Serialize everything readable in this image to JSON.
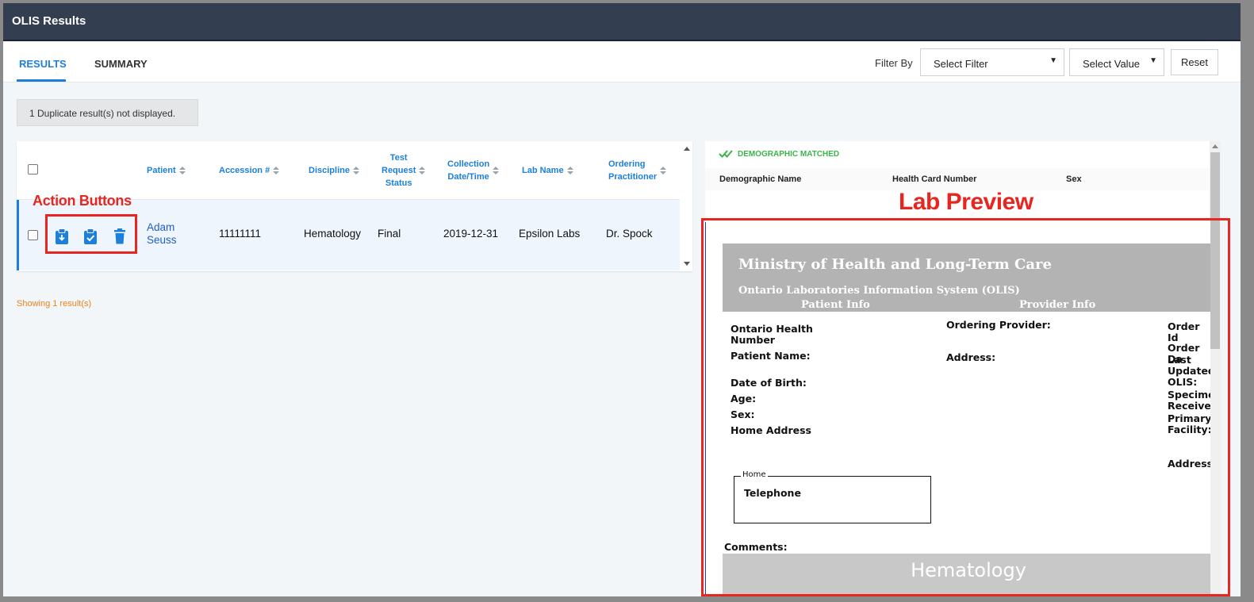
{
  "window": {
    "title": "OLIS Results"
  },
  "tabs": [
    {
      "label": "RESULTS",
      "active": true
    },
    {
      "label": "SUMMARY",
      "active": false
    }
  ],
  "filter": {
    "label": "Filter By",
    "select_filter": "Select Filter",
    "select_value": "Select Value",
    "reset": "Reset"
  },
  "notice": {
    "duplicate": "1 Duplicate result(s) not displayed."
  },
  "table": {
    "headers": {
      "patient": "Patient",
      "accession": "Accession #",
      "discipline": "Discipline",
      "status_l1": "Test",
      "status_l2": "Request",
      "status_l3": "Status",
      "collection_l1": "Collection",
      "collection_l2": "Date/Time",
      "lab": "Lab Name",
      "ordering_l1": "Ordering",
      "ordering_l2": "Practitioner"
    },
    "rows": [
      {
        "patient_first": "Adam",
        "patient_last": "Seuss",
        "accession": "11111111",
        "discipline": "Hematology",
        "status": "Final",
        "collection": "2019-12-31",
        "lab": "Epsilon Labs",
        "practitioner": "Dr. Spock"
      }
    ]
  },
  "annotations": {
    "action_buttons": "Action Buttons",
    "lab_preview": "Lab Preview"
  },
  "showing": "Showing 1 result(s)",
  "demographic": {
    "status": "DEMOGRAPHIC MATCHED",
    "col_name": "Demographic Name",
    "col_hcn": "Health Card Number",
    "col_sex": "Sex"
  },
  "report": {
    "ministry": "Ministry of Health and Long-Term Care",
    "system": "Ontario Laboratories Information System (OLIS)",
    "patient_info": "Patient Info",
    "provider_info": "Provider Info",
    "ohn_l1": "Ontario Health",
    "ohn_l2": "Number",
    "patient_name": "Patient Name:",
    "dob": "Date of Birth:",
    "age": "Age:",
    "sex": "Sex:",
    "home_address": "Home Address",
    "ordering_provider": "Ordering Provider:",
    "address": "Address:",
    "order_id": "Order Id",
    "order_date": "Order Da",
    "last_updated_l1": "Last",
    "last_updated_l2": "Updated",
    "last_updated_l3": "OLIS:",
    "specimen_l1": "Specime",
    "specimen_l2": "Received",
    "primary_l1": "Primary",
    "primary_l2": "Facility:",
    "address_right": "Address:",
    "home_legend": "Home",
    "telephone": "Telephone",
    "comments": "Comments:",
    "discipline_banner": "Hematology"
  },
  "colors": {
    "titlebar": "#333e51",
    "accent": "#1d7fd8",
    "annotation": "#e8261f",
    "matched": "#3bb54a",
    "showing": "#e8831c"
  },
  "icons": [
    "download-clipboard-icon",
    "check-clipboard-icon",
    "trash-icon",
    "double-check-icon",
    "sort-icon",
    "dropdown-arrow-icon"
  ]
}
